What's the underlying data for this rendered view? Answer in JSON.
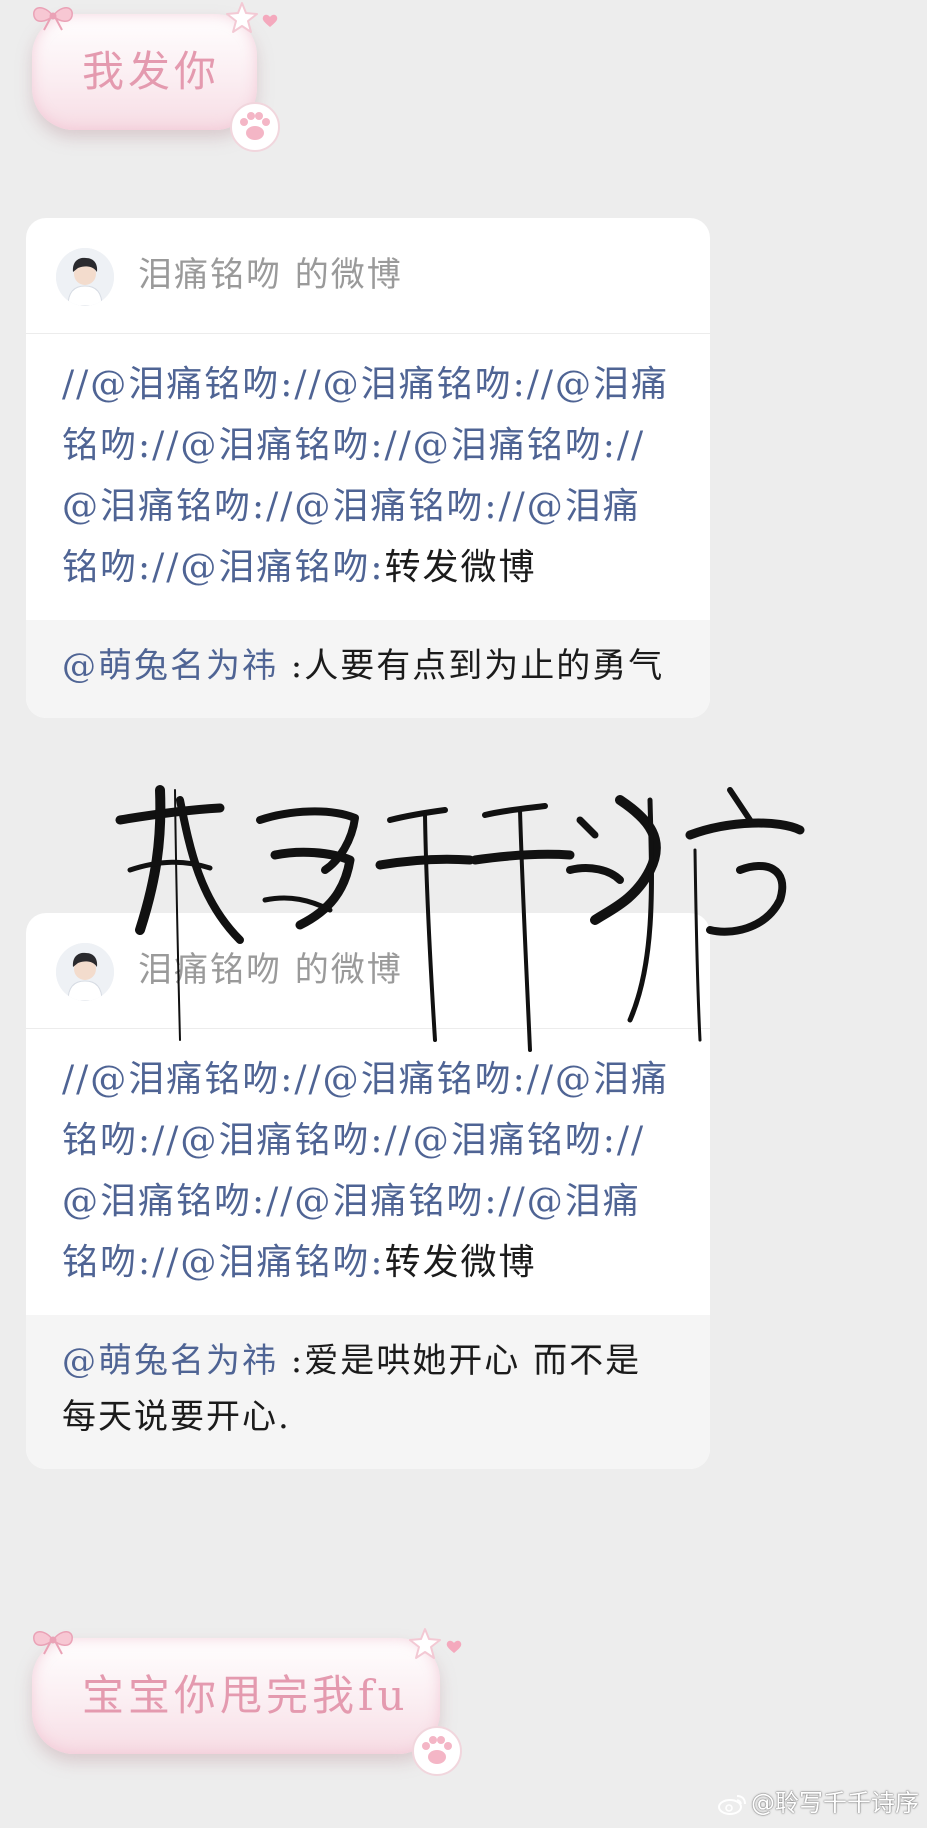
{
  "messages": [
    {
      "type": "sticker_text",
      "text": "我发你"
    },
    {
      "type": "repost_card",
      "header": {
        "title": "泪痛铭吻  的微博"
      },
      "body": {
        "mentions": [
          "//@泪痛铭吻:",
          "//@泪痛铭吻:",
          "//@泪痛铭吻:",
          "//@泪痛铭吻:",
          "//@泪痛铭吻:",
          "//@泪痛铭吻:",
          "//@泪痛铭吻:",
          "//@泪痛铭吻:",
          "//@泪痛铭吻:"
        ],
        "tail_text": "转发微博"
      },
      "quote": {
        "author": "@萌兔名为祎",
        "text": " :人要有点到为止的勇气"
      }
    },
    {
      "type": "repost_card",
      "header": {
        "title": "泪痛铭吻  的微博"
      },
      "body": {
        "mentions": [
          "//@泪痛铭吻:",
          "//@泪痛铭吻:",
          "//@泪痛铭吻:",
          "//@泪痛铭吻:",
          "//@泪痛铭吻:",
          "//@泪痛铭吻:",
          "//@泪痛铭吻:",
          "//@泪痛铭吻:",
          "//@泪痛铭吻:"
        ],
        "tail_text": "转发微博"
      },
      "quote": {
        "author": "@萌兔名为祎",
        "text": " :爱是哄她开心 而不是每天说要开心."
      }
    },
    {
      "type": "sticker_text",
      "text": "宝宝你甩完我fu"
    }
  ],
  "overlay": {
    "calligraphy_text": "聆写千千诗序"
  },
  "watermark": {
    "text": "@聆写千千诗序",
    "icon": "weibo-icon"
  },
  "colors": {
    "background": "#ededed",
    "mention": "#4f6494",
    "sticker_text": "#e49aaf",
    "card": "#ffffff",
    "quote_bg": "#f5f5f5"
  }
}
